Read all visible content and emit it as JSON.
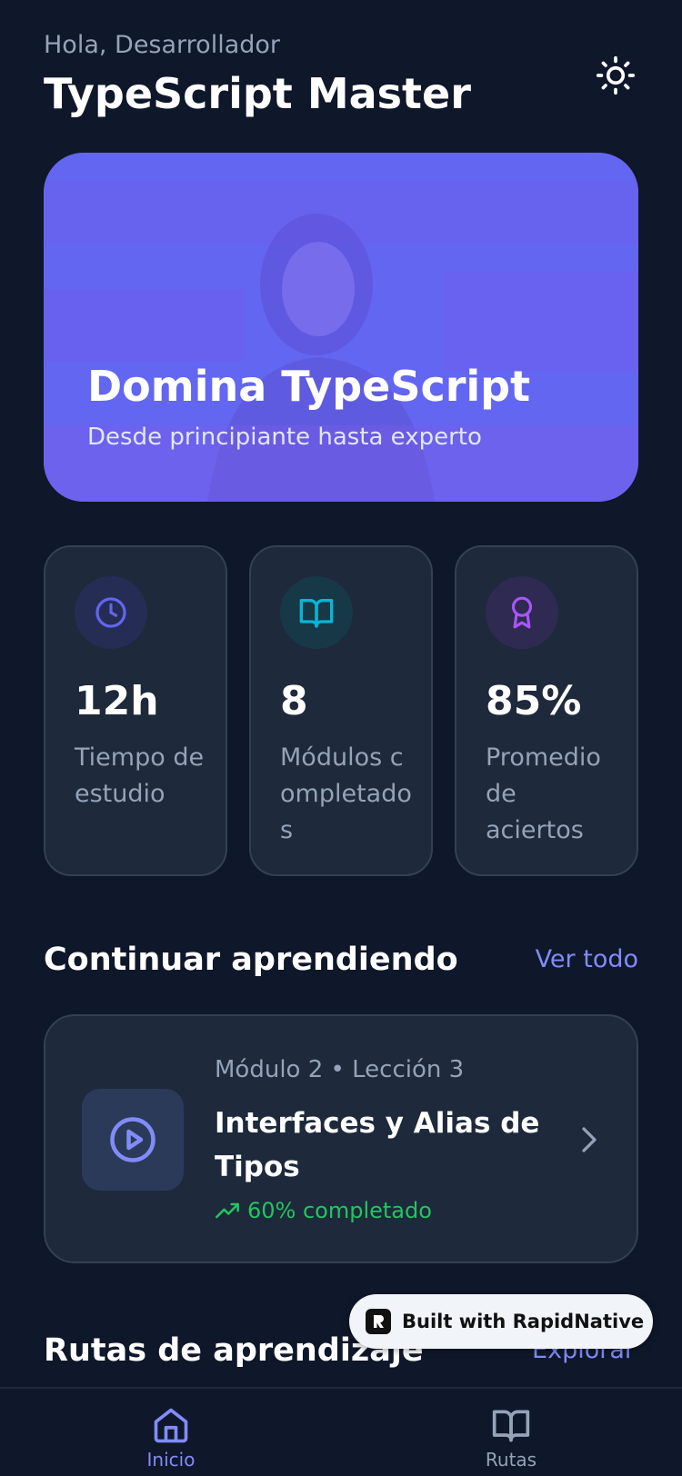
{
  "header": {
    "greeting": "Hola, Desarrollador",
    "title": "TypeScript Master"
  },
  "hero": {
    "title": "Domina TypeScript",
    "subtitle": "Desde principiante hasta experto"
  },
  "stats": [
    {
      "icon": "clock-icon",
      "value": "12h",
      "label": "Tiempo de estudio",
      "color": "#6366f1",
      "bg": "#262d55"
    },
    {
      "icon": "book-open-icon",
      "value": "8",
      "label": "Módulos completados",
      "color": "#06b6d4",
      "bg": "#173847"
    },
    {
      "icon": "award-icon",
      "value": "85%",
      "label": "Promedio de aciertos",
      "color": "#a855f7",
      "bg": "#2e2a52"
    }
  ],
  "continue": {
    "section_title": "Continuar aprendiendo",
    "link": "Ver todo",
    "meta": "Módulo 2 • Lección 3",
    "lesson_title": "Interfaces y Alias de Tipos",
    "progress_text": "60% completado",
    "progress": 0.6
  },
  "paths": {
    "section_title": "Rutas de aprendizaje",
    "link": "Explorar"
  },
  "badge": {
    "text": "Built with RapidNative"
  },
  "nav": {
    "items": [
      {
        "label": "Inicio",
        "active": true
      },
      {
        "label": "Rutas",
        "active": false
      }
    ]
  },
  "colors": {
    "background": "#0f172a",
    "card": "#1e293b",
    "accent": "#818cf8",
    "success": "#22c55e"
  }
}
